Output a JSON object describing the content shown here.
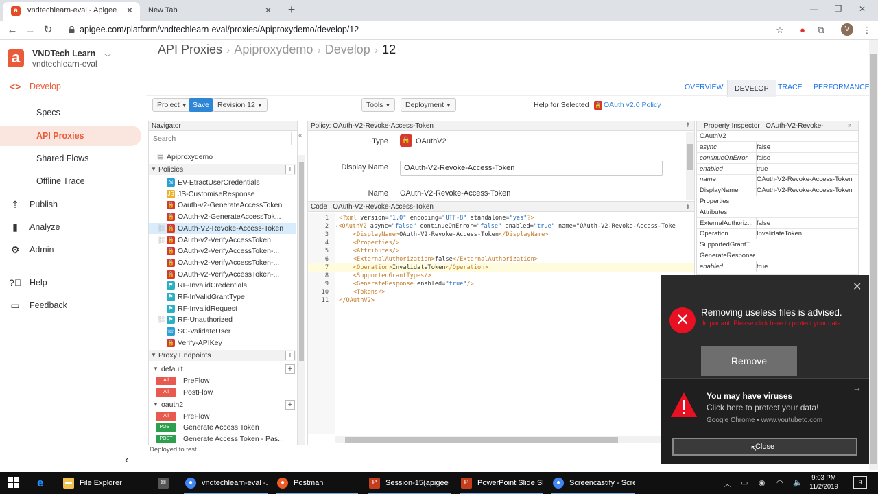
{
  "browser": {
    "tabs": [
      {
        "title": "vndtechlearn-eval - Apigee",
        "active": true
      },
      {
        "title": "New Tab",
        "active": false
      }
    ],
    "url": "apigee.com/platform/vndtechlearn-eval/proxies/Apiproxydemo/develop/12",
    "profile_initial": "V"
  },
  "sidebar": {
    "org_name": "VNDTech Learn",
    "org_id": "vndtechlearn-eval",
    "items": [
      {
        "label": "Develop",
        "icon": "code-icon"
      },
      {
        "label": "Specs"
      },
      {
        "label": "API Proxies"
      },
      {
        "label": "Shared Flows"
      },
      {
        "label": "Offline Trace"
      },
      {
        "label": "Publish",
        "icon": "publish-icon"
      },
      {
        "label": "Analyze",
        "icon": "bar-chart-icon"
      },
      {
        "label": "Admin",
        "icon": "gear-icon"
      },
      {
        "label": "Help",
        "icon": "help-icon"
      },
      {
        "label": "Feedback",
        "icon": "feedback-icon"
      }
    ]
  },
  "header": {
    "breadcrumb": [
      "API Proxies",
      "Apiproxydemo",
      "Develop"
    ],
    "revision": "12",
    "tabs": [
      "OVERVIEW",
      "DEVELOP",
      "TRACE",
      "PERFORMANCE"
    ]
  },
  "toolbar": {
    "project": "Project",
    "save": "Save",
    "revision": "Revision 12",
    "tools": "Tools",
    "deployment": "Deployment",
    "help_label": "Help for Selected",
    "help_link": "OAuth v2.0 Policy"
  },
  "navigator": {
    "title": "Navigator",
    "search_placeholder": "Search",
    "proxy_name": "Apiproxydemo",
    "policies_label": "Policies",
    "policies": [
      {
        "label": "EV-EtractUserCredentials",
        "icon": "extract-variables-icon",
        "color": "#2a9fd6"
      },
      {
        "label": "JS-CustomiseResponse",
        "icon": "javascript-icon",
        "color": "#e8b32b"
      },
      {
        "label": "Oauth-v2-GenerateAccessToken",
        "icon": "lock-icon",
        "color": "#d9382c"
      },
      {
        "label": "OAuth-v2-GenerateAccessTok...",
        "icon": "lock-icon",
        "color": "#d9382c"
      },
      {
        "label": "OAuth-V2-Revoke-Access-Token",
        "icon": "lock-icon",
        "color": "#d9382c"
      },
      {
        "label": "OAuth-v2-VerifyAccessToken",
        "icon": "lock-icon",
        "color": "#d9382c"
      },
      {
        "label": "OAuth-v2-VerifyAccessToken-...",
        "icon": "lock-icon",
        "color": "#d9382c"
      },
      {
        "label": "OAuth-v2-VerifyAccessToken-...",
        "icon": "lock-icon",
        "color": "#d9382c"
      },
      {
        "label": "OAuth-v2-VerifyAccessToken-...",
        "icon": "lock-icon",
        "color": "#d9382c"
      },
      {
        "label": "RF-InvalidCredentials",
        "icon": "raise-fault-icon",
        "color": "#2ab0c4"
      },
      {
        "label": "RF-InValidGrantType",
        "icon": "raise-fault-icon",
        "color": "#2ab0c4"
      },
      {
        "label": "RF-InvalidRequest",
        "icon": "raise-fault-icon",
        "color": "#2ab0c4"
      },
      {
        "label": "RF-Unauthorized",
        "icon": "raise-fault-icon",
        "color": "#2ab0c4"
      },
      {
        "label": "SC-ValidateUser",
        "icon": "service-callout-icon",
        "color": "#2a9fd6"
      },
      {
        "label": "Verify-APIKey",
        "icon": "lock-icon",
        "color": "#d9382c"
      }
    ],
    "endpoints_label": "Proxy Endpoints",
    "endpoints": [
      {
        "name": "default",
        "flows": [
          {
            "tag": "All",
            "label": "PreFlow"
          },
          {
            "tag": "All",
            "label": "PostFlow"
          }
        ]
      },
      {
        "name": "oauth2",
        "flows": [
          {
            "tag": "All",
            "label": "PreFlow"
          },
          {
            "tag": "POST",
            "label": "Generate Access Token"
          },
          {
            "tag": "POST",
            "label": "Generate Access Token - Pas..."
          }
        ]
      }
    ],
    "status": "Deployed to test"
  },
  "policy": {
    "header": "Policy: OAuth-V2-Revoke-Access-Token",
    "type_label": "Type",
    "type_value": "OAuthV2",
    "display_name_label": "Display Name",
    "display_name_value": "OAuth-V2-Revoke-Access-Token",
    "name_label": "Name",
    "name_value": "OAuth-V2-Revoke-Access-Token"
  },
  "code": {
    "header_label": "Code",
    "header_name": "OAuth-V2-Revoke-Access-Token",
    "highlighted_line": 7,
    "lines": [
      "<?xml version=\"1.0\" encoding=\"UTF-8\" standalone=\"yes\"?>",
      "<OAuthV2 async=\"false\" continueOnError=\"false\" enabled=\"true\" name=\"OAuth-V2-Revoke-Access-Toke",
      "    <DisplayName>OAuth-V2-Revoke-Access-Token</DisplayName>",
      "    <Properties/>",
      "    <Attributes/>",
      "    <ExternalAuthorization>false</ExternalAuthorization>",
      "    <Operation>InvalidateToken</Operation>",
      "    <SupportedGrantTypes/>",
      "    <GenerateResponse enabled=\"true\"/>",
      "    <Tokens/>",
      "</OAuthV2>"
    ]
  },
  "inspector": {
    "title": "Property Inspector",
    "subject": "OAuth-V2-Revoke-",
    "root": "OAuthV2",
    "rows": [
      {
        "key": "async",
        "value": "false",
        "italic": true
      },
      {
        "key": "continueOnError",
        "value": "false",
        "italic": true
      },
      {
        "key": "enabled",
        "value": "true",
        "italic": true
      },
      {
        "key": "name",
        "value": "OAuth-V2-Revoke-Access-Token",
        "italic": true
      },
      {
        "key": "DisplayName",
        "value": "OAuth-V2-Revoke-Access-Token",
        "italic": false
      },
      {
        "key": "Properties",
        "value": "",
        "italic": false
      },
      {
        "key": "Attributes",
        "value": "",
        "italic": false
      },
      {
        "key": "ExternalAuthoriz...",
        "value": "false",
        "italic": false
      },
      {
        "key": "Operation",
        "value": "InvalidateToken",
        "italic": false
      },
      {
        "key": "SupportedGrantT...",
        "value": "",
        "italic": false
      },
      {
        "key": "GenerateResponse",
        "value": "",
        "italic": false
      },
      {
        "key": "enabled",
        "value": "true",
        "italic": true
      }
    ]
  },
  "popup_cleanup": {
    "title": "Removing useless files is advised.",
    "subtitle": "Important: Please click here to protect your data.",
    "button": "Remove"
  },
  "popup_virus": {
    "title": "You may have viruses",
    "subtitle": "Click here to protect your data!",
    "source": "Google Chrome • www.youtubeto.com",
    "button": "Close"
  },
  "taskbar": {
    "items": [
      {
        "label": "File Explorer",
        "icon": "folder-icon",
        "color": "#f2c14e"
      },
      {
        "label": "vndtechlearn-eval -...",
        "icon": "chrome-icon",
        "color": "#4285f4"
      },
      {
        "label": "Postman",
        "icon": "postman-icon",
        "color": "#ef5b25"
      },
      {
        "label": "Session-15(apigee ...",
        "icon": "powerpoint-icon",
        "color": "#c43e1c"
      },
      {
        "label": "PowerPoint Slide Sh...",
        "icon": "powerpoint-icon",
        "color": "#c43e1c"
      },
      {
        "label": "Screencastify - Scre...",
        "icon": "chrome-icon",
        "color": "#4285f4"
      }
    ],
    "time": "9:03 PM",
    "date": "11/2/2019",
    "notifications": "9"
  },
  "colors": {
    "accent": "#ea5b3a",
    "link": "#1a73e8",
    "save": "#2e86d6"
  }
}
